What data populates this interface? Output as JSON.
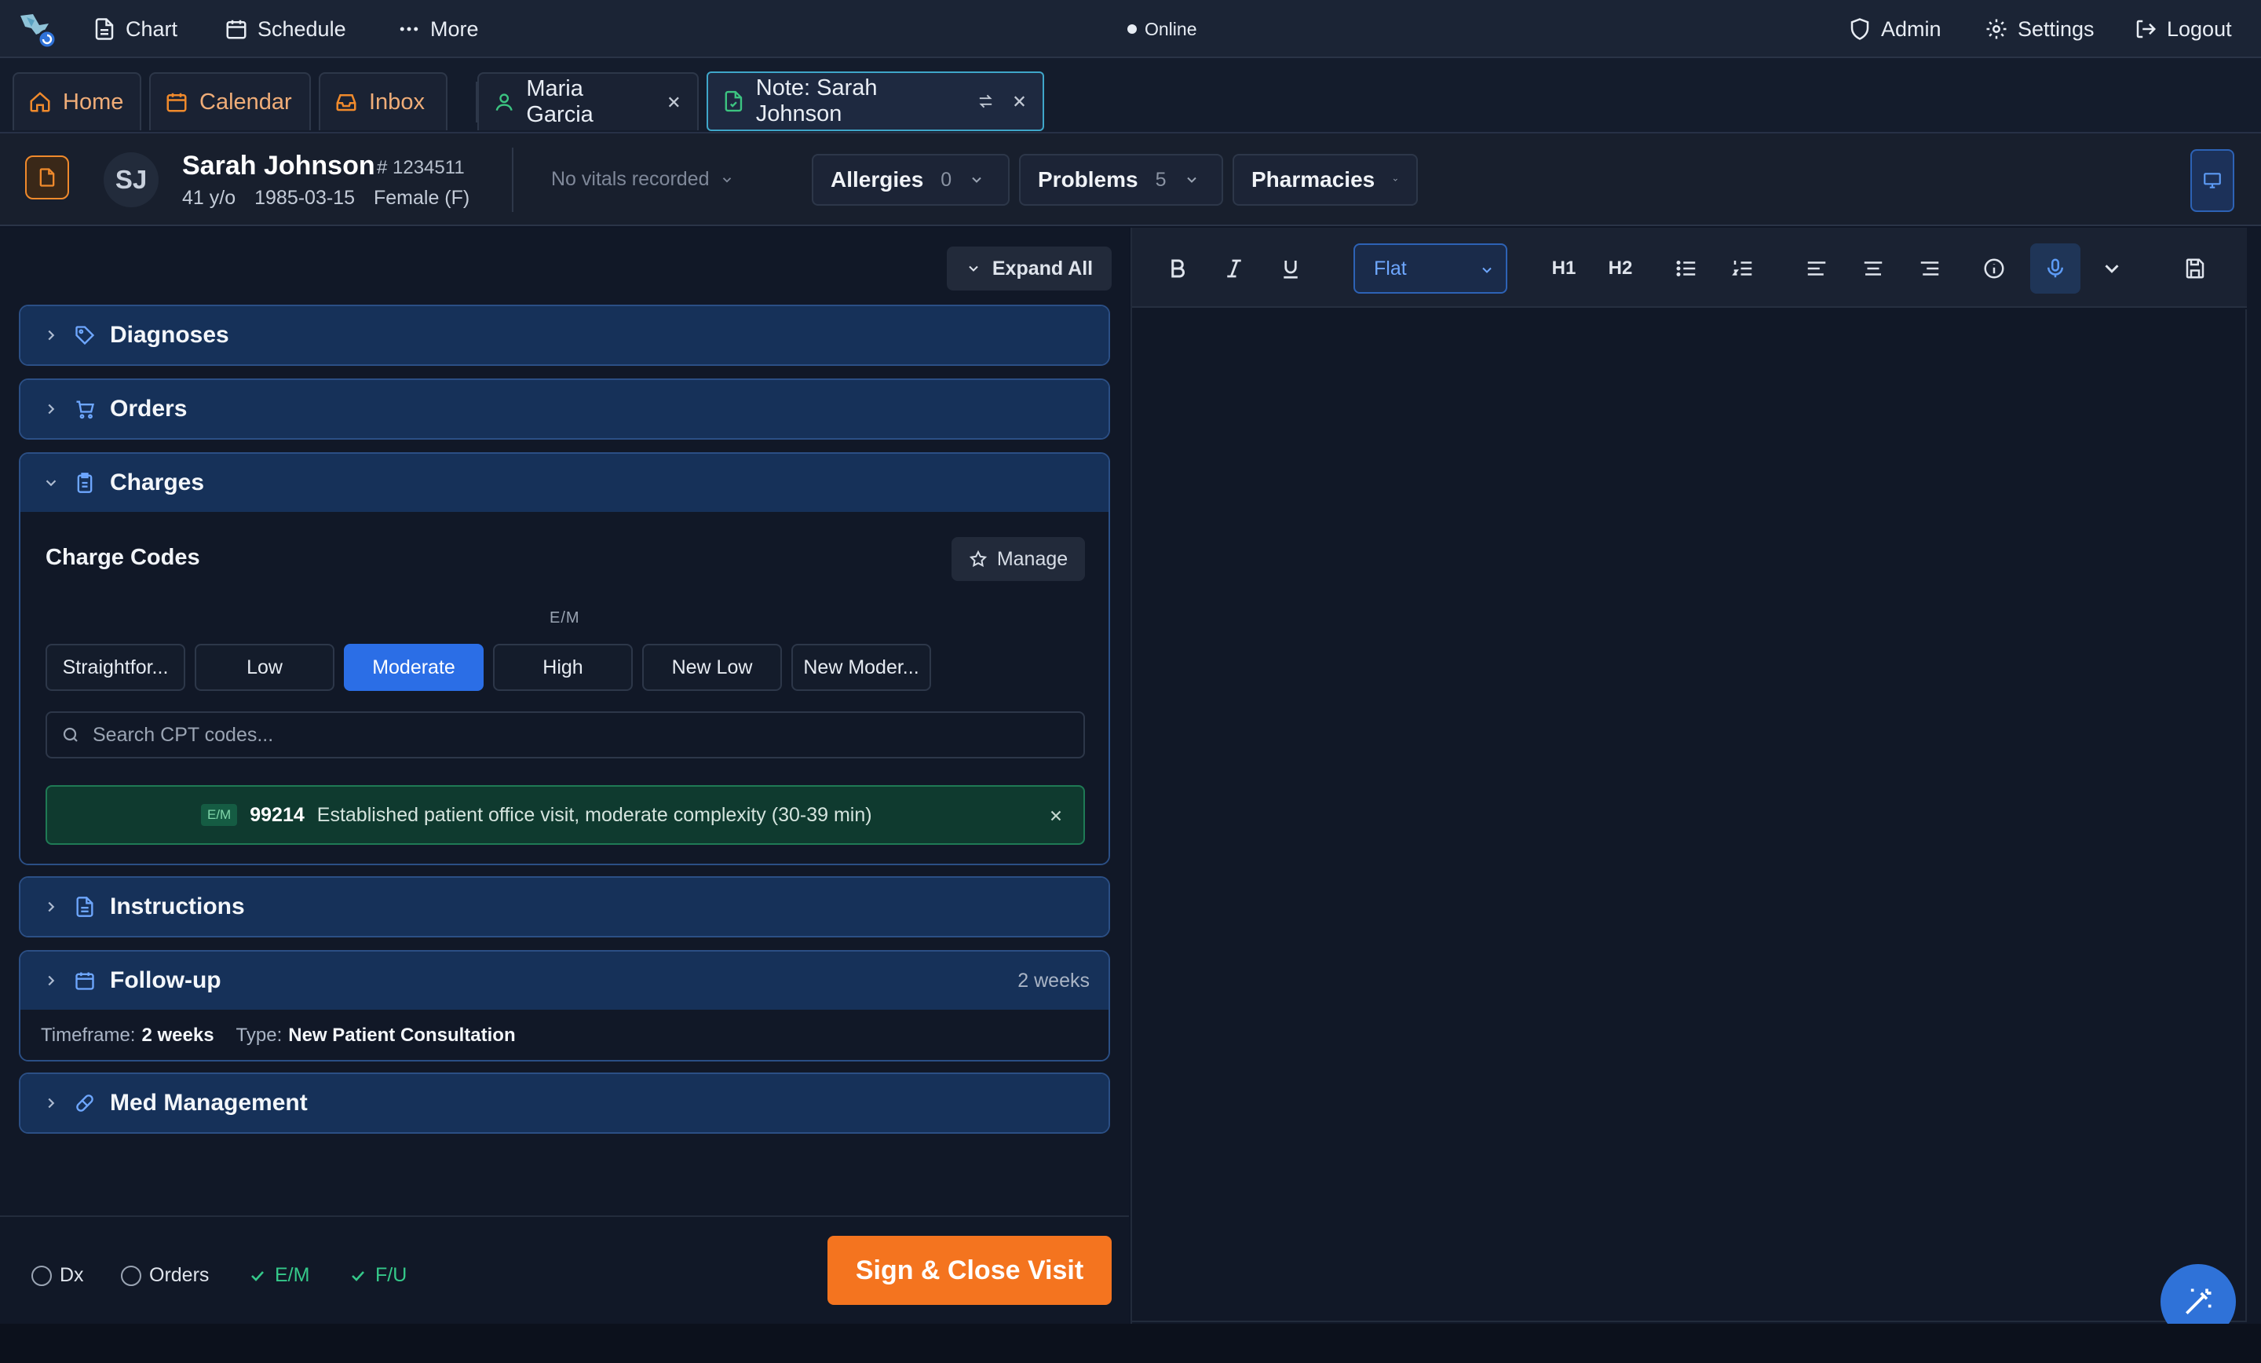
{
  "topbar": {
    "nav": [
      {
        "label": "Chart",
        "icon": "document-icon"
      },
      {
        "label": "Schedule",
        "icon": "calendar-icon"
      },
      {
        "label": "More",
        "icon": "ellipsis-icon"
      }
    ],
    "status": "Online",
    "right": [
      {
        "label": "Admin",
        "icon": "shield-icon"
      },
      {
        "label": "Settings",
        "icon": "gear-icon"
      },
      {
        "label": "Logout",
        "icon": "logout-icon"
      }
    ]
  },
  "tabs": {
    "fixed": [
      {
        "label": "Home",
        "icon": "home-icon"
      },
      {
        "label": "Calendar",
        "icon": "calendar-icon"
      },
      {
        "label": "Inbox",
        "icon": "inbox-icon"
      }
    ],
    "open": [
      {
        "label": "Maria Garcia",
        "icon": "user-icon"
      },
      {
        "label": "Note: Sarah Johnson",
        "icon": "note-icon",
        "active": true
      }
    ]
  },
  "patient": {
    "initials": "SJ",
    "name": "Sarah Johnson",
    "mrn": "# 1234511",
    "age": "41 y/o",
    "dob": "1985-03-15",
    "sex": "Female (F)",
    "vitals": "No vitals recorded",
    "chips": [
      {
        "label": "Allergies",
        "count": "0"
      },
      {
        "label": "Problems",
        "count": "5"
      },
      {
        "label": "Pharmacies",
        "count": ""
      }
    ]
  },
  "left": {
    "expand_all": "Expand All",
    "sections": {
      "diagnoses": "Diagnoses",
      "orders": "Orders",
      "charges": "Charges",
      "instructions": "Instructions",
      "followup": "Follow-up",
      "followup_right": "2 weeks",
      "medmgmt": "Med Management"
    },
    "charges": {
      "title": "Charge Codes",
      "manage": "Manage",
      "em_label": "E/M",
      "levels": [
        "Straightfor...",
        "Low",
        "Moderate",
        "High",
        "New Low",
        "New Moder..."
      ],
      "selected_level": "Moderate",
      "search_placeholder": "Search CPT codes...",
      "code": {
        "badge": "E/M",
        "code": "99214",
        "description": "Established patient office visit, moderate complexity (30-39 min)"
      }
    },
    "followup": {
      "timeframe_label": "Timeframe:",
      "timeframe": "2 weeks",
      "type_label": "Type:",
      "type": "New Patient Consultation"
    },
    "checklist": [
      {
        "label": "Dx",
        "done": false
      },
      {
        "label": "Orders",
        "done": false
      },
      {
        "label": "E/M",
        "done": true
      },
      {
        "label": "F/U",
        "done": true
      }
    ],
    "sign_button": "Sign & Close Visit"
  },
  "editor": {
    "style_select": "Flat",
    "h1": "H1",
    "h2": "H2"
  },
  "colors": {
    "accent_blue": "#2b6ee6",
    "accent_orange": "#f4741f",
    "success_green": "#35c98a"
  }
}
